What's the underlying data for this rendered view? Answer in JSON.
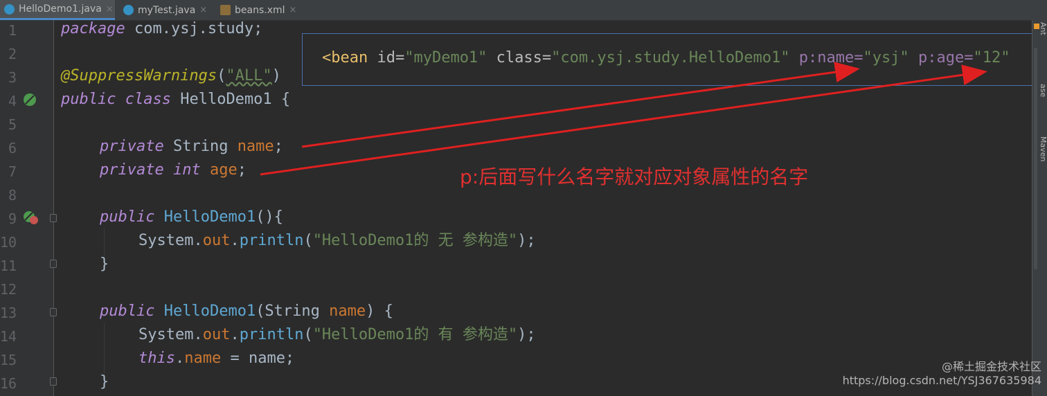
{
  "tabs": [
    {
      "label": "HelloDemo1.java",
      "icon": "java-class-icon",
      "active": true
    },
    {
      "label": "myTest.java",
      "icon": "java-class-icon",
      "active": false
    },
    {
      "label": "beans.xml",
      "icon": "xml-file-icon",
      "active": false
    }
  ],
  "close_glyph": "×",
  "line_numbers": [
    "1",
    "2",
    "3",
    "4",
    "5",
    "6",
    "7",
    "8",
    "9",
    "10",
    "11",
    "12",
    "13",
    "14",
    "15",
    "16"
  ],
  "code": {
    "l1_kw": "package",
    "l1_rest": " com.ysj.study;",
    "l3_anno": "@SuppressWarnings",
    "l3_open": "(",
    "l3_str": "\"ALL\"",
    "l3_close": ")",
    "l4_kw1": "public",
    "l4_kw2": "class",
    "l4_name": " HelloDemo1 {",
    "l6_kw": "private",
    "l6_type": " String ",
    "l6_field": "name",
    "l6_end": ";",
    "l7_kw": "private",
    "l7_type": "int",
    "l7_field": "age",
    "l7_end": ";",
    "l9_kw": "public",
    "l9_name": "HelloDemo1",
    "l9_end": "(){",
    "l10_sys": "System.",
    "l10_out": "out",
    "l10_dot": ".",
    "l10_println": "println",
    "l10_open": "(",
    "l10_str": "\"HelloDemo1的 无 参构造\"",
    "l10_end": ");",
    "l11": "}",
    "l13_kw": "public",
    "l13_name": "HelloDemo1",
    "l13_params": "(String ",
    "l13_param": "name",
    "l13_end": ") {",
    "l14_sys": "System.",
    "l14_out": "out",
    "l14_dot": ".",
    "l14_println": "println",
    "l14_open": "(",
    "l14_str": "\"HelloDemo1的 有 参构造\"",
    "l14_end": ");",
    "l15_this": "this",
    "l15_dot": ".",
    "l15_field": "name",
    "l15_rest": " = name;",
    "l16": "}"
  },
  "popup": {
    "open": "<bean",
    "id_attr": " id=",
    "id_val": "\"myDemo1\"",
    "class_attr": " class=",
    "class_val": "\"com.ysj.study.HelloDemo1\"",
    "pname_attr": " p:name=",
    "pname_val": "\"ysj\"",
    "page_attr": " p:age=",
    "page_val": "\"12\""
  },
  "annotation": "p:后面写什么名字就对应对象属性的名字",
  "right_toolbar": [
    "Ant",
    "ase",
    "Maven"
  ],
  "watermark": {
    "line1": "@稀土掘金技术社区",
    "line2": "https://blog.csdn.net/YSJ367635984"
  },
  "colors": {
    "editor_bg": "#2b2b2b",
    "keyword": "#cc7832",
    "string": "#6a8759",
    "field": "#9876aa",
    "annotation_red": "#e03030",
    "popup_border": "#4b6eaf"
  }
}
